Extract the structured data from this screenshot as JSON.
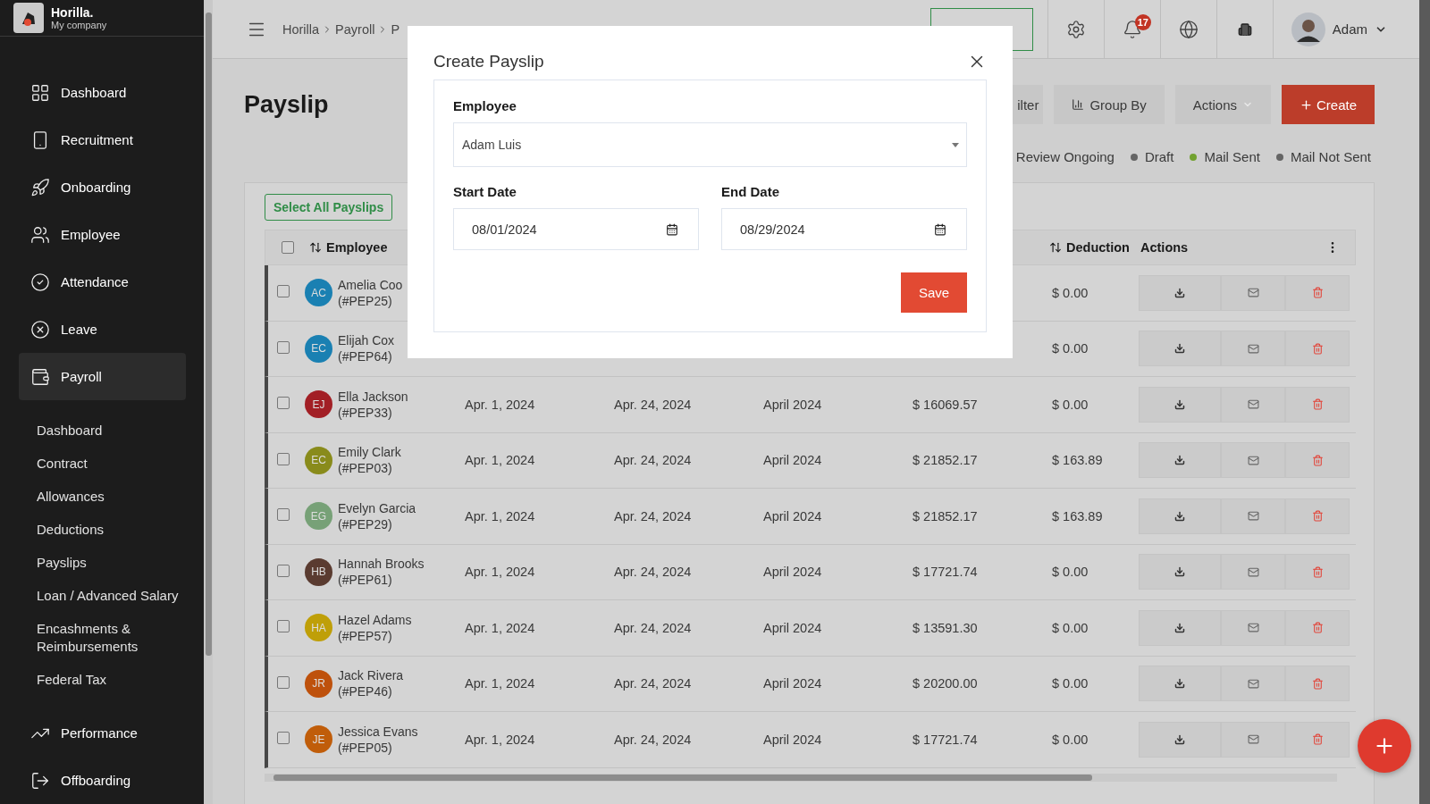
{
  "brand": {
    "name": "Horilla.",
    "company": "My company"
  },
  "sidebar": {
    "items": [
      {
        "label": "Dashboard",
        "selected": false
      },
      {
        "label": "Recruitment",
        "selected": false
      },
      {
        "label": "Onboarding",
        "selected": false
      },
      {
        "label": "Employee",
        "selected": false
      },
      {
        "label": "Attendance",
        "selected": false
      },
      {
        "label": "Leave",
        "selected": false
      },
      {
        "label": "Payroll",
        "selected": true,
        "expanded": true,
        "children": [
          {
            "label": "Dashboard"
          },
          {
            "label": "Contract"
          },
          {
            "label": "Allowances"
          },
          {
            "label": "Deductions"
          },
          {
            "label": "Payslips"
          },
          {
            "label": "Loan / Advanced Salary"
          },
          {
            "label": "Encashments & Reimbursements"
          },
          {
            "label": "Federal Tax"
          }
        ]
      },
      {
        "label": "Performance",
        "selected": false
      },
      {
        "label": "Offboarding",
        "selected": false
      }
    ]
  },
  "breadcrumb": [
    "Horilla",
    "Payroll",
    "P"
  ],
  "topbar": {
    "notifications": "17",
    "user": "Adam"
  },
  "page": {
    "title": "Payslip",
    "buttons": {
      "filter": "ilter",
      "group_by": "Group By",
      "actions": "Actions",
      "create": "Create"
    },
    "legend": [
      {
        "label": "Review Ongoing"
      },
      {
        "label": "Draft",
        "color": "#656565"
      },
      {
        "label": "Mail Sent",
        "color": "#72a230"
      },
      {
        "label": "Mail Not Sent",
        "color": "#656565"
      }
    ]
  },
  "table": {
    "select_all": "Select All Payslips",
    "header_checked": false,
    "header": {
      "employee": "Employee",
      "deduction": "Deduction",
      "actions": "Actions"
    },
    "rows": [
      {
        "checked": false,
        "initials": "AC",
        "color": "#1a80b2",
        "employee": "Amelia Coo",
        "id": "(#PEP25)",
        "deduction": "$ 0.00"
      },
      {
        "checked": false,
        "initials": "EC",
        "color": "#1a80b2",
        "employee": "Elijah Cox",
        "id": "(#PEP64)",
        "deduction": "$ 0.00"
      },
      {
        "checked": false,
        "initials": "EJ",
        "color": "#a21f25",
        "employee": "Ella Jackson",
        "id": "(#PEP33)",
        "column_2": "Apr. 1, 2024",
        "column_3": "Apr. 24, 2024",
        "column_4": "April 2024",
        "column_5": "$ 16069.57",
        "deduction": "$ 0.00"
      },
      {
        "checked": false,
        "initials": "EC",
        "color": "#898b1b",
        "employee": "Emily Clark",
        "id": "(#PEP03)",
        "column_2": "Apr. 1, 2024",
        "column_3": "Apr. 24, 2024",
        "column_4": "April 2024",
        "column_5": "$ 21852.17",
        "deduction": "$ 163.89"
      },
      {
        "checked": false,
        "initials": "EG",
        "color": "#77a177",
        "employee": "Evelyn Garcia",
        "id": "(#PEP29)",
        "column_2": "Apr. 1, 2024",
        "column_3": "Apr. 24, 2024",
        "column_4": "April 2024",
        "column_5": "$ 21852.17",
        "deduction": "$ 163.89"
      },
      {
        "checked": false,
        "initials": "HB",
        "color": "#5a3b30",
        "employee": "Hannah Brooks",
        "id": "(#PEP61)",
        "column_2": "Apr. 1, 2024",
        "column_3": "Apr. 24, 2024",
        "column_4": "April 2024",
        "column_5": "$ 17721.74",
        "deduction": "$ 0.00"
      },
      {
        "checked": false,
        "initials": "HA",
        "color": "#bf9f08",
        "employee": "Hazel Adams",
        "id": "(#PEP57)",
        "column_2": "Apr. 1, 2024",
        "column_3": "Apr. 24, 2024",
        "column_4": "April 2024",
        "column_5": "$ 13591.30",
        "deduction": "$ 0.00"
      },
      {
        "checked": false,
        "initials": "JR",
        "color": "#be510c",
        "employee": "Jack Rivera",
        "id": "(#PEP46)",
        "column_2": "Apr. 1, 2024",
        "column_3": "Apr. 24, 2024",
        "column_4": "April 2024",
        "column_5": "$ 20200.00",
        "deduction": "$ 0.00"
      },
      {
        "checked": false,
        "initials": "JE",
        "color": "#c05d0a",
        "employee": "Jessica Evans",
        "id": "(#PEP05)",
        "column_2": "Apr. 1, 2024",
        "column_3": "Apr. 24, 2024",
        "column_4": "April 2024",
        "column_5": "$ 17721.74",
        "deduction": "$ 0.00"
      }
    ]
  },
  "modal": {
    "title": "Create Payslip",
    "employee_label": "Employee",
    "employee_value": "Adam Luis",
    "start_label": "Start Date",
    "start_value": "08/01/2024",
    "end_label": "End Date",
    "end_value": "08/29/2024",
    "save": "Save"
  }
}
